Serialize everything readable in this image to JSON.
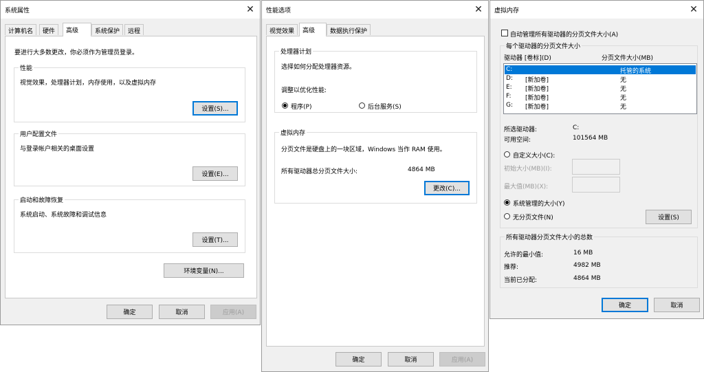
{
  "sys": {
    "title": "系统属性",
    "tabs": [
      "计算机名",
      "硬件",
      "高级",
      "系统保护",
      "远程"
    ],
    "admin_note": "要进行大多数更改，你必须作为管理员登录。",
    "perf": {
      "label": "性能",
      "desc": "视觉效果，处理器计划，内存使用，以及虚拟内存",
      "button": "设置(S)..."
    },
    "profile": {
      "label": "用户配置文件",
      "desc": "与登录帐户相关的桌面设置",
      "button": "设置(E)..."
    },
    "startup": {
      "label": "启动和故障恢复",
      "desc": "系统启动、系统故障和调试信息",
      "button": "设置(T)..."
    },
    "env_button": "环境变量(N)...",
    "ok": "确定",
    "cancel": "取消",
    "apply": "应用(A)"
  },
  "perf": {
    "title": "性能选项",
    "tabs": [
      "视觉效果",
      "高级",
      "数据执行保护"
    ],
    "sched": {
      "label": "处理器计划",
      "desc": "选择如何分配处理器资源。",
      "adjust": "调整以优化性能:",
      "opt_programs": "程序(P)",
      "opt_services": "后台服务(S)"
    },
    "vm": {
      "label": "虚拟内存",
      "desc": "分页文件是硬盘上的一块区域，Windows 当作 RAM 使用。",
      "total_label": "所有驱动器总分页文件大小:",
      "total_value": "4864 MB",
      "change_button": "更改(C)..."
    },
    "ok": "确定",
    "cancel": "取消",
    "apply": "应用(A)"
  },
  "vmem": {
    "title": "虚拟内存",
    "auto_manage": "自动管理所有驱动器的分页文件大小(A)",
    "per_drive_label": "每个驱动器的分页文件大小",
    "col_drive": "驱动器 [卷标](D)",
    "col_size": "分页文件大小(MB)",
    "drives": [
      {
        "letter": "C:",
        "label": "",
        "size": "托管的系统"
      },
      {
        "letter": "D:",
        "label": "[新加卷]",
        "size": "无"
      },
      {
        "letter": "E:",
        "label": "[新加卷]",
        "size": "无"
      },
      {
        "letter": "F:",
        "label": "[新加卷]",
        "size": "无"
      },
      {
        "letter": "G:",
        "label": "[新加卷]",
        "size": "无"
      }
    ],
    "selected_drive_label": "所选驱动器:",
    "selected_drive_value": "C:",
    "free_space_label": "可用空间:",
    "free_space_value": "101564 MB",
    "custom_size": "自定义大小(C):",
    "initial_size": "初始大小(MB)(I):",
    "max_size": "最大值(MB)(X):",
    "system_managed": "系统管理的大小(Y)",
    "no_paging": "无分页文件(N)",
    "set_button": "设置(S)",
    "totals_label": "所有驱动器分页文件大小的总数",
    "min_label": "允许的最小值:",
    "min_value": "16 MB",
    "rec_label": "推荐:",
    "rec_value": "4982 MB",
    "cur_label": "当前已分配:",
    "cur_value": "4864 MB",
    "ok": "确定",
    "cancel": "取消"
  }
}
